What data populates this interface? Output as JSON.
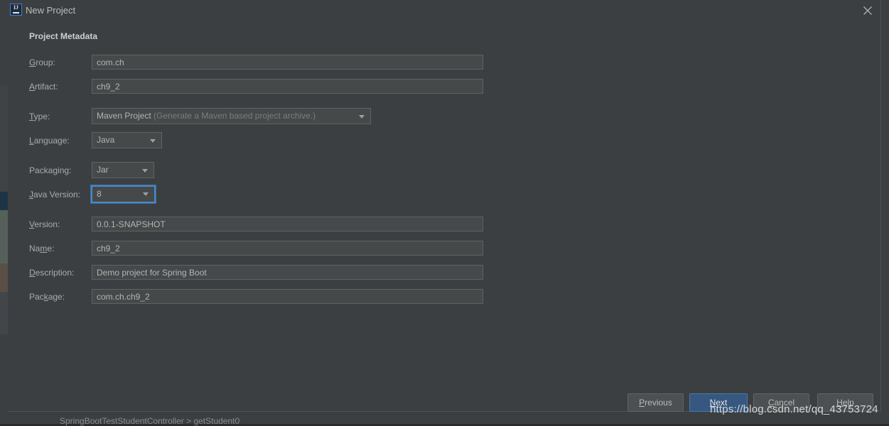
{
  "window": {
    "title": "New Project",
    "icon_name": "intellij-idea-icon",
    "icon_text": "IJ",
    "close_icon": "close-icon"
  },
  "section": {
    "title": "Project Metadata"
  },
  "fields": {
    "group": {
      "label_pre": "G",
      "label_mnemonic": "",
      "label": "Group:",
      "value": "com.ch"
    },
    "artifact": {
      "label": "Artifact:",
      "value": "ch9_2"
    },
    "type": {
      "label": "Type:",
      "value": "Maven Project",
      "hint": "(Generate a Maven based project archive.)"
    },
    "language": {
      "label": "Language:",
      "value": "Java"
    },
    "packaging": {
      "label": "Packaging:",
      "value": "Jar"
    },
    "java_version": {
      "label": "Java Version:",
      "value": "8",
      "focused": true
    },
    "version": {
      "label": "Version:",
      "value": "0.0.1-SNAPSHOT"
    },
    "name": {
      "label": "Name:",
      "value": "ch9_2"
    },
    "description": {
      "label": "Description:",
      "value": "Demo project for Spring Boot"
    },
    "package": {
      "label": "Package:",
      "value": "com.ch.ch9_2"
    }
  },
  "buttons": {
    "previous": "Previous",
    "next": "Next",
    "cancel": "Cancel",
    "help": "Help"
  },
  "background": {
    "breadcrumb": "SpringBootTestStudentController  >  getStudent0"
  },
  "watermark": "https://blog.csdn.net/qq_43753724",
  "colors": {
    "dialog_bg": "#3c3f41",
    "input_bg": "#45494a",
    "input_border": "#5e6364",
    "focus_blue": "#4a88c7",
    "default_button": "#365880",
    "text": "#bbbbbb",
    "hint_text": "#7a7e80"
  }
}
